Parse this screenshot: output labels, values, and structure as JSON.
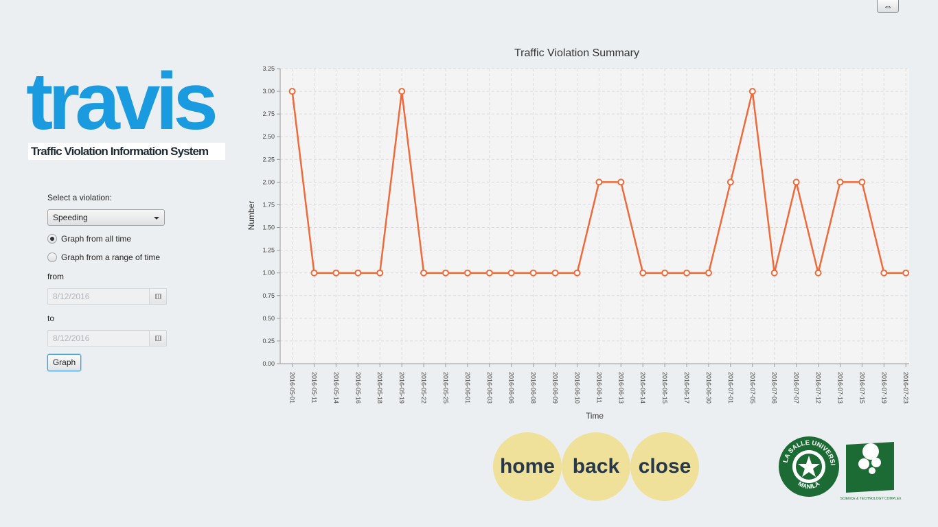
{
  "window": {
    "resize_glyph": "⇔"
  },
  "logo": {
    "word": "travis",
    "subtitle": "Traffic Violation Information System"
  },
  "controls": {
    "select_label": "Select a violation:",
    "violation_selected": "Speeding",
    "radio_all_time": "Graph from all time",
    "radio_range": "Graph from a range of time",
    "from_label": "from",
    "from_date": "8/12/2016",
    "to_label": "to",
    "to_date": "8/12/2016",
    "graph_button": "Graph"
  },
  "nav": {
    "home": "home",
    "back": "back",
    "close": "close"
  },
  "colors": {
    "accent": "#1a9be0",
    "series": "#ef6a3a",
    "button": "#efe09a",
    "seal_green": "#1d6b34"
  },
  "seals": {
    "dlsu_top": "DE LA SALLE UNIVERSITY",
    "dlsu_bottom": "MANILA",
    "stc_caption": "SCIENCE & TECHNOLOGY COMPLEX"
  },
  "chart_data": {
    "type": "line",
    "title": "Traffic Violation Summary",
    "xlabel": "Time",
    "ylabel": "Number",
    "ylim": [
      0,
      3.25
    ],
    "ytick_step": 0.25,
    "grid": true,
    "categories": [
      "2016-05-01",
      "2016-05-11",
      "2016-05-14",
      "2016-05-16",
      "2016-05-18",
      "2016-05-19",
      "2016-05-22",
      "2016-05-25",
      "2016-06-01",
      "2016-06-03",
      "2016-06-06",
      "2016-06-08",
      "2016-06-09",
      "2016-06-10",
      "2016-06-11",
      "2016-06-13",
      "2016-06-14",
      "2016-06-15",
      "2016-06-17",
      "2016-06-30",
      "2016-07-01",
      "2016-07-05",
      "2016-07-06",
      "2016-07-07",
      "2016-07-12",
      "2016-07-13",
      "2016-07-15",
      "2016-07-19",
      "2016-07-23"
    ],
    "values": [
      3,
      1,
      1,
      1,
      1,
      3,
      1,
      1,
      1,
      1,
      1,
      1,
      1,
      1,
      2,
      2,
      1,
      1,
      1,
      1,
      2,
      3,
      1,
      2,
      1,
      2,
      2,
      1,
      1
    ]
  }
}
